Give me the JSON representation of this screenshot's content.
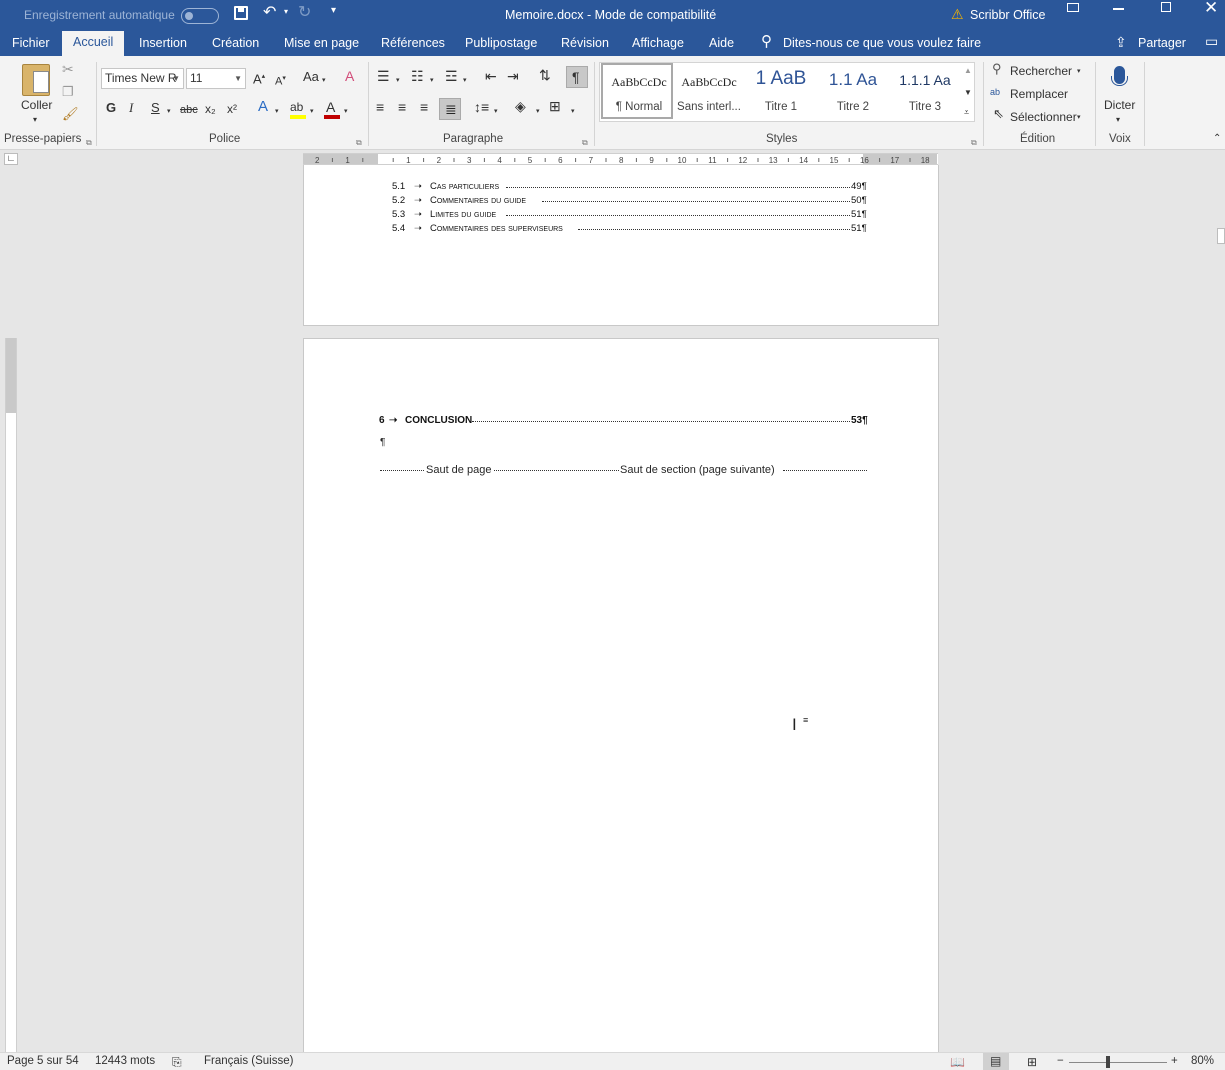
{
  "titlebar": {
    "autosave_label": "Enregistrement automatique",
    "document_title": "Memoire.docx  -  Mode de compatibilité",
    "addin_label": "Scribbr Office"
  },
  "tabs": [
    "Fichier",
    "Accueil",
    "Insertion",
    "Création",
    "Mise en page",
    "Références",
    "Publipostage",
    "Révision",
    "Affichage",
    "Aide"
  ],
  "tell_me": "Dites-nous ce que vous voulez faire",
  "share_label": "Partager",
  "ribbon": {
    "clipboard": {
      "paste_label": "Coller",
      "group_label": "Presse-papiers"
    },
    "font": {
      "font_name": "Times New R",
      "font_size": "11",
      "change_case": "Aa",
      "group_label": "Police",
      "bold": "G",
      "italic": "I",
      "underline": "S",
      "strike": "abc",
      "subscript": "x₂",
      "superscript": "x²"
    },
    "paragraph": {
      "group_label": "Paragraphe",
      "pilcrow": "¶"
    },
    "styles": {
      "group_label": "Styles",
      "items": [
        {
          "preview": "AaBbCcDc",
          "name": "¶ Normal"
        },
        {
          "preview": "AaBbCcDc",
          "name": "Sans interl..."
        },
        {
          "preview": "1  AaB",
          "name": "Titre 1"
        },
        {
          "preview": "1.1  Aa",
          "name": "Titre 2"
        },
        {
          "preview": "1.1.1  Aa",
          "name": "Titre 3"
        }
      ]
    },
    "editing": {
      "group_label": "Édition",
      "find": "Rechercher",
      "replace": "Remplacer",
      "select": "Sélectionner"
    },
    "voice": {
      "group_label": "Voix",
      "dictate": "Dicter"
    }
  },
  "toc_page": {
    "entries": [
      {
        "num": "5.1",
        "title": "Cas particuliers",
        "page": "49¶"
      },
      {
        "num": "5.2",
        "title": "Commentaires du guide",
        "page": "50¶"
      },
      {
        "num": "5.3",
        "title": "Limites du guide",
        "page": "51¶"
      },
      {
        "num": "5.4",
        "title": "Commentaires des superviseurs",
        "page": "51¶"
      }
    ]
  },
  "page2": {
    "conclusion_num": "6",
    "conclusion_title": "CONCLUSION",
    "conclusion_page": "53¶",
    "pilcrow": "¶",
    "page_break": "Saut de page",
    "section_break": "Saut de section (page suivante)"
  },
  "statusbar": {
    "page": "Page 5 sur 54",
    "words": "12443 mots",
    "language": "Français (Suisse)",
    "zoom": "80%"
  },
  "colors": {
    "accent": "#2b579a",
    "font_color": "#c00000",
    "highlight": "#ffff00"
  }
}
